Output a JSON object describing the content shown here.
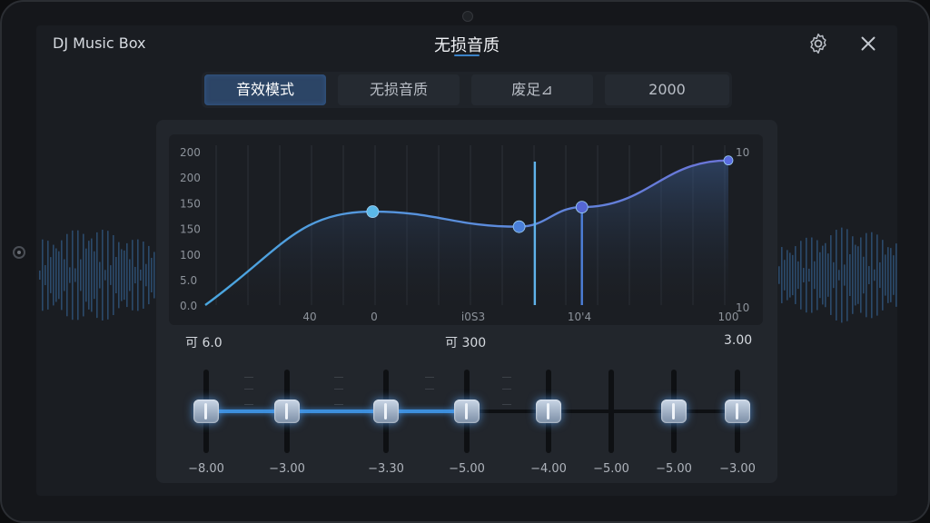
{
  "app": {
    "name": "DJ Music Box",
    "title": "无损音质"
  },
  "icons": {
    "settings": "gear-icon",
    "close": "close-icon"
  },
  "tabs": [
    {
      "label": "音效模式",
      "active": true
    },
    {
      "label": "无损音质",
      "active": false
    },
    {
      "label": "废足⊿",
      "active": false
    },
    {
      "label": "2000",
      "active": false
    }
  ],
  "chart_data": {
    "type": "line",
    "y_ticks": [
      "200",
      "200",
      "150",
      "150",
      "100",
      "5.0",
      "0.0",
      "0"
    ],
    "x_ticks": [
      "40",
      "0",
      "i0S3",
      "10'4",
      "100"
    ],
    "right_ticks": [
      "10",
      "10"
    ],
    "points": [
      {
        "x": 0.0,
        "y": 0.0
      },
      {
        "x": 0.32,
        "y": 0.62
      },
      {
        "x": 0.6,
        "y": 0.52
      },
      {
        "x": 0.72,
        "y": 0.65
      },
      {
        "x": 1.0,
        "y": 0.96
      }
    ],
    "markers": [
      0.32,
      0.6,
      0.72,
      1.0
    ],
    "cursor_lines": [
      0.63,
      0.72
    ]
  },
  "sliders": {
    "labels": {
      "left": "可 6.0",
      "center": "可 300",
      "right": "3.00"
    },
    "bands": [
      {
        "value": "−8.00",
        "level": 0.5
      },
      {
        "value": "−3.00",
        "level": 0.5
      },
      {
        "value": "−3.30",
        "level": 0.5
      },
      {
        "value": "−5.00",
        "level": 0.5
      },
      {
        "value": "−4.00",
        "level": 0.5
      },
      {
        "value": "−5.00",
        "level": null
      },
      {
        "value": "−5.00",
        "level": 0.5
      },
      {
        "value": "−3.00",
        "level": 0.5
      }
    ]
  },
  "colors": {
    "accent": "#4a9be0",
    "curve": "#5aa8e6",
    "marker": "#3f78d8"
  }
}
